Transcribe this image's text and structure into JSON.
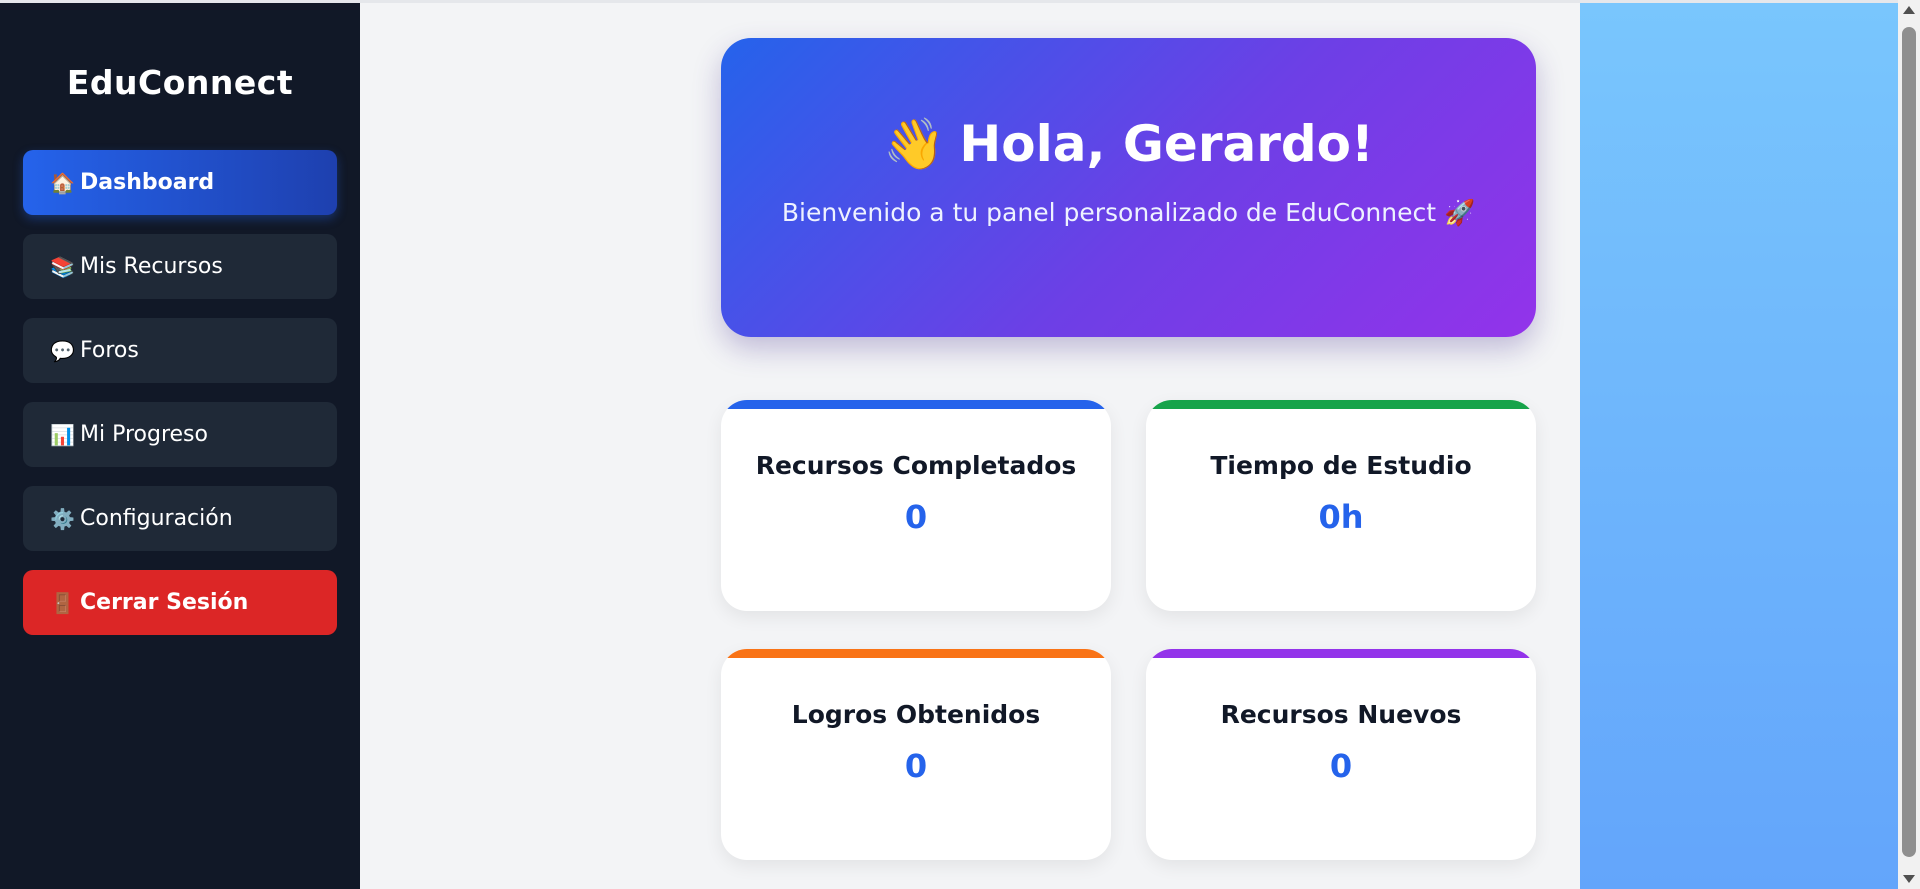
{
  "sidebar": {
    "brand": "EduConnect",
    "items": [
      {
        "icon": "🏠",
        "label": "Dashboard"
      },
      {
        "icon": "📚",
        "label": "Mis Recursos"
      },
      {
        "icon": "💬",
        "label": "Foros"
      },
      {
        "icon": "📊",
        "label": "Mi Progreso"
      },
      {
        "icon": "⚙️",
        "label": "Configuración"
      },
      {
        "icon": "🚪",
        "label": "Cerrar Sesión"
      }
    ]
  },
  "hero": {
    "emoji": "👋",
    "title": "Hola, Gerardo!",
    "subtitle": "Bienvenido a tu panel personalizado de EduConnect 🚀"
  },
  "stats": [
    {
      "label": "Recursos Completados",
      "value": "0",
      "accent": "#2563eb"
    },
    {
      "label": "Tiempo de Estudio",
      "value": "0h",
      "accent": "#16a34a"
    },
    {
      "label": "Logros Obtenidos",
      "value": "0",
      "accent": "#f97316"
    },
    {
      "label": "Recursos Nuevos",
      "value": "0",
      "accent": "#9333ea"
    }
  ],
  "colors": {
    "sidebar_bg": "#111827",
    "active_nav": "#2563eb",
    "logout": "#dc2626",
    "stat_value": "#2563eb"
  }
}
